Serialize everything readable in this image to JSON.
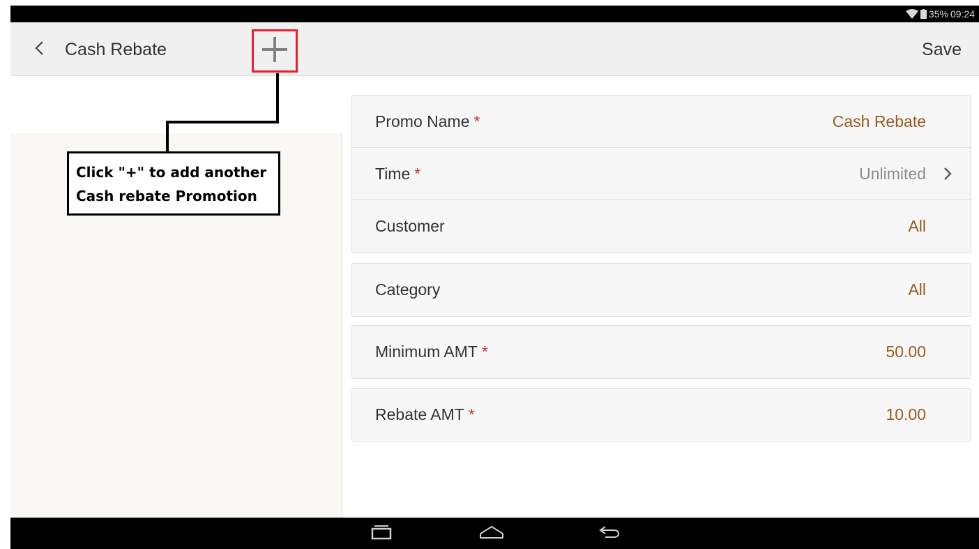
{
  "status_bar": {
    "battery": "35%",
    "time": "09:24",
    "icons": [
      "wifi-icon",
      "battery-icon"
    ]
  },
  "action_bar": {
    "title": "Cash Rebate",
    "save_label": "Save",
    "add_label": "+",
    "back_icon": "chevron-left-icon"
  },
  "form": {
    "rows": [
      {
        "label": "Promo Name",
        "required": "*",
        "value": "Cash Rebate"
      },
      {
        "label": "Time",
        "required": "*",
        "value": "Unlimited"
      },
      {
        "label": "Customer",
        "value": "All"
      },
      {
        "label": "Category",
        "value": "All"
      },
      {
        "label": "Minimum AMT",
        "required": "*",
        "value": "50.00"
      },
      {
        "label": "Rebate AMT",
        "required": "*",
        "value": "10.00"
      }
    ]
  },
  "callout": {
    "line1": "Click \"+\" to add another",
    "line2": "Cash rebate Promotion"
  },
  "nav_bar": {
    "icons": [
      "recent-apps-icon",
      "home-icon",
      "back-icon"
    ]
  },
  "colors": {
    "value": "#9a5a1d",
    "required": "#c0392b",
    "highlight": "#e8202a"
  }
}
